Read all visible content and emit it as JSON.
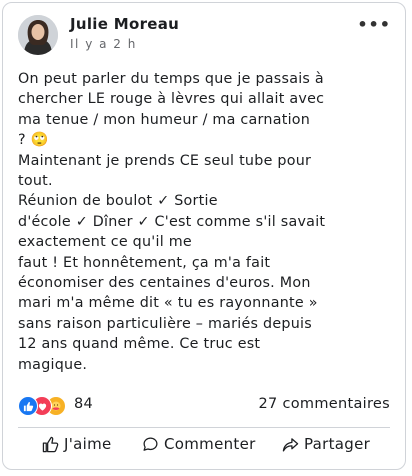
{
  "post": {
    "author": "Julie Moreau",
    "time": "Il y a 2 h",
    "body_lines": [
      "On peut parler du temps que je passais à",
      "chercher LE rouge à lèvres qui allait avec",
      "ma tenue / mon humeur / ma carnation",
      "? 🙄",
      "Maintenant je prends CE seul tube pour",
      "tout.",
      "Réunion de boulot ✓ Sortie",
      "d'école ✓ Dîner ✓ C'est comme s'il savait",
      "exactement ce qu'il me",
      "faut ! Et honnêtement, ça m'a fait",
      "économiser des centaines d'euros. Mon",
      "mari m'a même dit « tu es rayonnante »",
      "sans raison particulière – mariés depuis",
      "12 ans quand même. Ce truc est",
      "magique."
    ]
  },
  "stats": {
    "reactions_count": "84",
    "comments_count": "27 commentaires",
    "reaction_icons": [
      "like-icon",
      "love-icon",
      "care-icon"
    ]
  },
  "actions": {
    "like_label": "J'aime",
    "comment_label": "Commenter",
    "share_label": "Partager"
  },
  "colors": {
    "like": "#1877f2",
    "love": "#f33e58",
    "care": "#f7b125",
    "muted_text": "#65676b",
    "divider": "#d0d3d8"
  }
}
